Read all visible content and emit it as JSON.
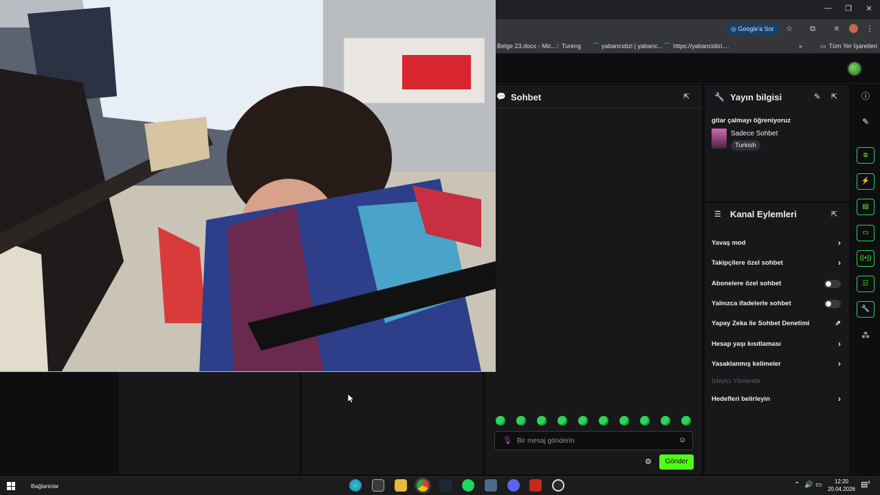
{
  "browser": {
    "window_controls": {
      "minimize": "—",
      "maximize": "❐",
      "close": "✕"
    },
    "google_ask": "Google'a Sor",
    "bookmarks": [
      {
        "label": "Belge 23.docx - Mic...",
        "icon": "word-icon"
      },
      {
        "label": "Tureng",
        "icon": "tureng-icon"
      },
      {
        "label": "yabancıdizi | yabanc...",
        "icon": "site-icon"
      },
      {
        "label": "https://yabancidizi....",
        "icon": "site-icon"
      }
    ],
    "more_bookmarks": "»",
    "all_bookmarks": "Tüm Yer İşaretleri"
  },
  "chat": {
    "title": "Sohbet",
    "placeholder": "Bir mesaj gönderin",
    "send_label": "Gönder",
    "emote_count": 10
  },
  "stream_info": {
    "title": "Yayın bilgisi",
    "stream_title": "gitar çalmayı öğreniyoruz",
    "category": "Sadece Sohbet",
    "language": "Turkish"
  },
  "channel_actions": {
    "title": "Kanal Eylemleri",
    "items": [
      {
        "label": "Yavaş mod",
        "control": "chevron"
      },
      {
        "label": "Takipçilere özel sohbet",
        "control": "chevron"
      },
      {
        "label": "Abonelere özel sohbet",
        "control": "toggle"
      },
      {
        "label": "Yalnızca ifadelerle sohbet",
        "control": "toggle"
      },
      {
        "label": "Yapay Zeka ile Sohbet Denetimi",
        "control": "external"
      },
      {
        "label": "Hesap yaşı kısıtlaması",
        "control": "chevron"
      },
      {
        "label": "Yasaklanmış kelimeler",
        "control": "chevron"
      },
      {
        "label": "İzleyici Yönlendir",
        "control": "disabled"
      },
      {
        "label": "Hedefleri belirleyin",
        "control": "chevron"
      }
    ]
  },
  "taskbar": {
    "start_label": "Bağlantılar",
    "time": "12:20",
    "date": "20.04.2026",
    "notification_count": "4"
  },
  "colors": {
    "accent": "#53fc18",
    "panel": "#18181b",
    "background": "#0e0e10"
  }
}
